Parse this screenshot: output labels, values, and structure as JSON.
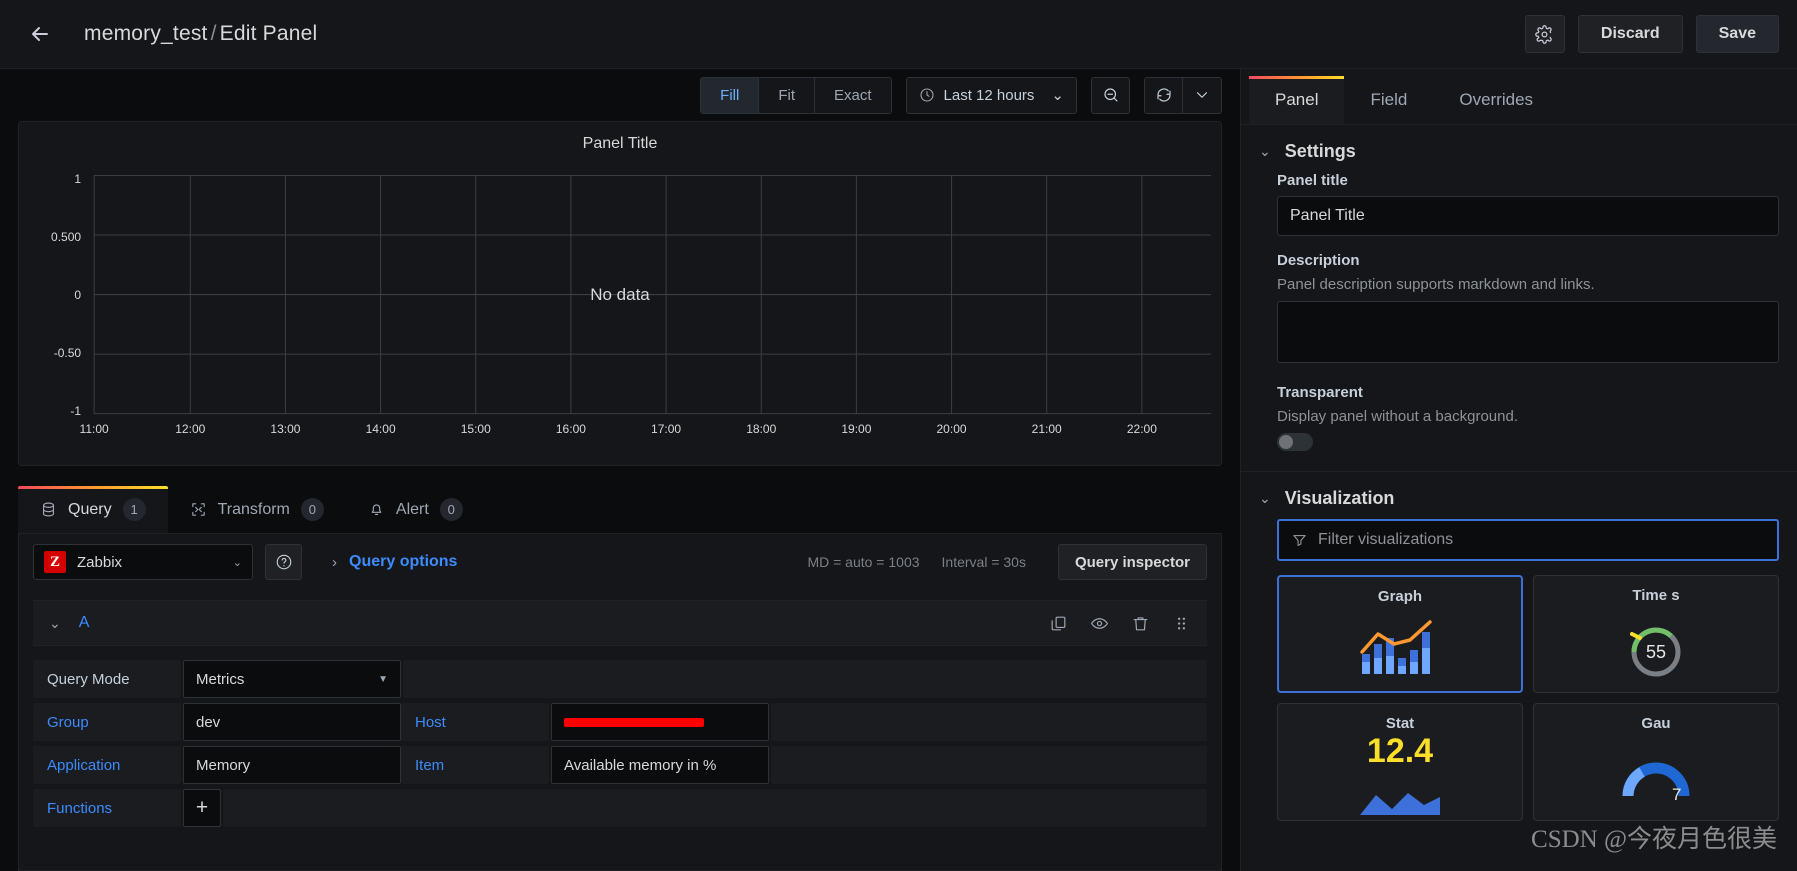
{
  "header": {
    "back_icon": "arrow-left-icon",
    "dashboard_name": "memory_test",
    "separator": "/",
    "page_label": "Edit Panel",
    "settings_icon": "gear-icon",
    "discard_label": "Discard",
    "save_label": "Save"
  },
  "viz_toolbar": {
    "size_modes": [
      {
        "label": "Fill",
        "active": true
      },
      {
        "label": "Fit",
        "active": false
      },
      {
        "label": "Exact",
        "active": false
      }
    ],
    "time_range": "Last 12 hours",
    "clock_icon": "clock-icon",
    "time_caret_icon": "chevron-down-icon",
    "zoom_out_icon": "zoom-out-icon",
    "refresh_icon": "refresh-icon",
    "refresh_caret_icon": "chevron-down-icon"
  },
  "panel": {
    "title": "Panel Title",
    "no_data": "No data"
  },
  "chart_data": {
    "type": "line",
    "title": "Panel Title",
    "xlabel": "",
    "ylabel": "",
    "series": [],
    "x_ticks": [
      "11:00",
      "12:00",
      "13:00",
      "14:00",
      "15:00",
      "16:00",
      "17:00",
      "18:00",
      "19:00",
      "20:00",
      "21:00",
      "22:00"
    ],
    "y_ticks": [
      "1",
      "0.500",
      "0",
      "-0.50",
      "-1"
    ],
    "ylim": [
      -1,
      1
    ],
    "grid": true,
    "legend": "none",
    "empty_message": "No data"
  },
  "query_tabs": [
    {
      "label": "Query",
      "count": "1",
      "icon": "database-icon",
      "active": true
    },
    {
      "label": "Transform",
      "count": "0",
      "icon": "transform-icon",
      "active": false
    },
    {
      "label": "Alert",
      "count": "0",
      "icon": "bell-icon",
      "active": false
    }
  ],
  "datasource": {
    "logo_text": "Z",
    "name": "Zabbix",
    "caret_icon": "chevron-down-icon",
    "help_icon": "help-circle-icon",
    "query_options_chevron": "chevron-right-icon",
    "query_options_label": "Query options",
    "max_data_points": "MD = auto = 1003",
    "interval": "Interval = 30s",
    "query_inspector_label": "Query inspector"
  },
  "query_row": {
    "collapse_icon": "chevron-down-icon",
    "ref_id": "A",
    "duplicate_icon": "copy-icon",
    "hide_icon": "eye-icon",
    "delete_icon": "trash-icon",
    "drag_icon": "drag-handle-icon",
    "fields": {
      "query_mode_label": "Query Mode",
      "query_mode_value": "Metrics",
      "group_label": "Group",
      "group_value": "dev",
      "host_label": "Host",
      "host_value": "",
      "application_label": "Application",
      "application_value": "Memory",
      "item_label": "Item",
      "item_value": "Available memory in %",
      "functions_label": "Functions",
      "add_function": "+"
    }
  },
  "options_pane": {
    "tabs": [
      {
        "label": "Panel",
        "active": true
      },
      {
        "label": "Field",
        "active": false
      },
      {
        "label": "Overrides",
        "active": false
      }
    ],
    "settings": {
      "section_title": "Settings",
      "panel_title_label": "Panel title",
      "panel_title_value": "Panel Title",
      "description_label": "Description",
      "description_help": "Panel description supports markdown and links.",
      "description_value": "",
      "transparent_label": "Transparent",
      "transparent_help": "Display panel without a background.",
      "transparent_on": false
    },
    "visualization": {
      "section_title": "Visualization",
      "filter_placeholder": "Filter visualizations",
      "filter_icon": "filter-icon",
      "cards": [
        {
          "name": "Graph",
          "selected": true
        },
        {
          "name": "Time s",
          "selected": false
        },
        {
          "name": "Stat",
          "selected": false,
          "value": "12.4"
        },
        {
          "name": "Gau",
          "selected": false
        }
      ]
    }
  },
  "watermark": "CSDN @今夜月色很美",
  "colors": {
    "accent_blue": "#3d8bfd",
    "tab_gradient_start": "#f2495c",
    "tab_gradient_end": "#fade2a",
    "panel_bg": "#141619",
    "app_bg": "#0b0c0e",
    "stat_yellow": "#fade2a",
    "redaction": "#ff0000"
  }
}
